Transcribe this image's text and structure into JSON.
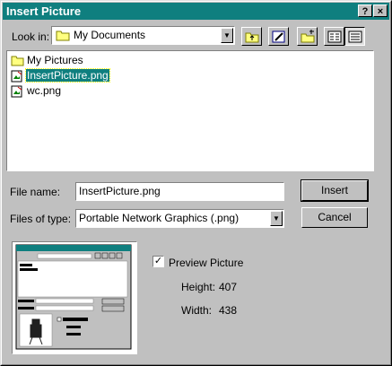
{
  "window": {
    "title": "Insert Picture",
    "help_label": "?",
    "close_label": "×"
  },
  "look_in": {
    "label": "Look in:",
    "value": "My Documents"
  },
  "toolbar": {
    "buttons": [
      "up-one-level",
      "search-web",
      "create-new-folder",
      "list",
      "details"
    ]
  },
  "files": [
    {
      "name": "My Pictures",
      "icon": "folder-icon"
    },
    {
      "name": "InsertPicture.png",
      "icon": "png-file-icon",
      "selected": true
    },
    {
      "name": "wc.png",
      "icon": "png-file-icon"
    }
  ],
  "file_name": {
    "label": "File name:",
    "value": "InsertPicture.png"
  },
  "file_type": {
    "label": "Files of type:",
    "value": "Portable Network Graphics (.png)"
  },
  "buttons": {
    "insert": "Insert",
    "cancel": "Cancel"
  },
  "preview": {
    "checkbox_label": "Preview Picture",
    "checked": true,
    "height_label": "Height:",
    "height_value": "407",
    "width_label": "Width:",
    "width_value": "438"
  },
  "colors": {
    "title_bar": "#0f7f7f",
    "face": "#c0c0c0",
    "selection": "#0f7f7f"
  }
}
